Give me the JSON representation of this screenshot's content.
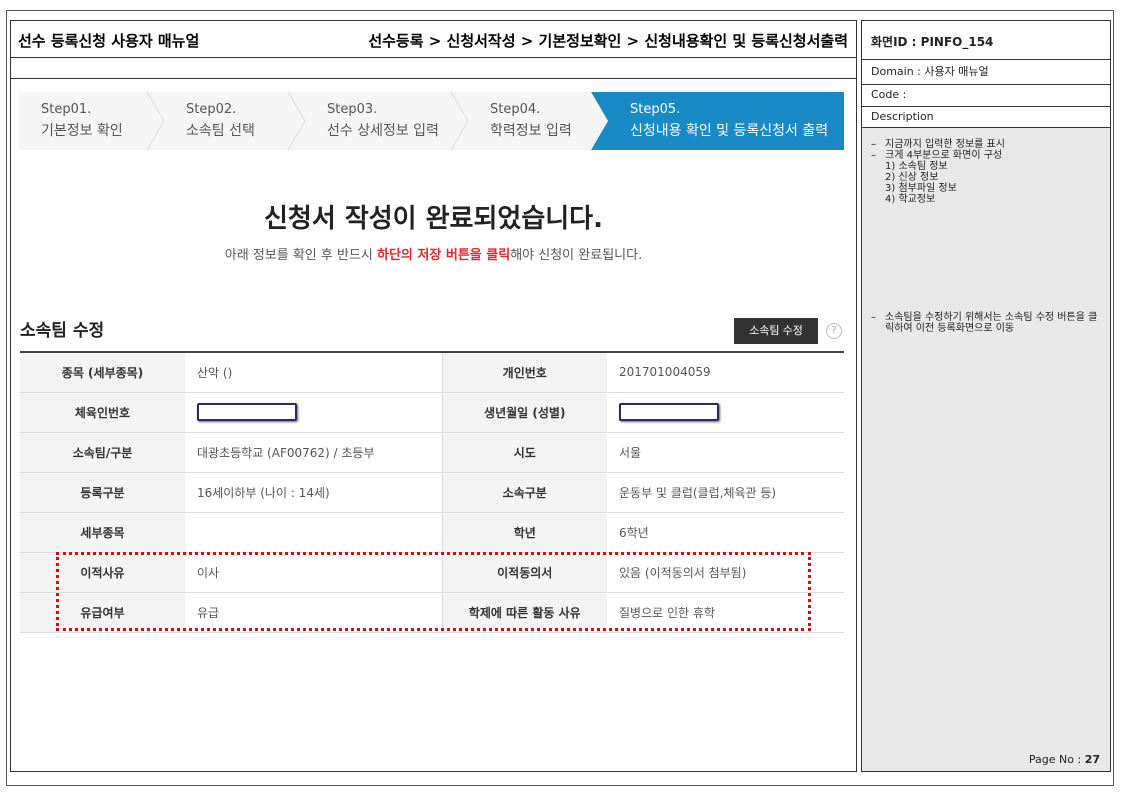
{
  "header": {
    "title": "선수 등록신청 사용자 매뉴얼",
    "path": "선수등록 > 신청서작성 > 기본정보확인 > 신청내용확인 및 등록신청서출력"
  },
  "steps": [
    {
      "num": "Step01.",
      "label": "기본정보 확인"
    },
    {
      "num": "Step02.",
      "label": "소속팀 선택"
    },
    {
      "num": "Step03.",
      "label": "선수 상세정보 입력"
    },
    {
      "num": "Step04.",
      "label": "학력정보 입력"
    },
    {
      "num": "Step05.",
      "label": "신청내용 확인 및 등록신청서 출력"
    }
  ],
  "complete": {
    "title": "신청서 작성이 완료되었습니다.",
    "sub_before": "아래 정보를 확인 후 반드시 ",
    "sub_emphasis": "하단의 저장 버튼을 클릭",
    "sub_after": "해야 신청이 완료됩니다."
  },
  "section": {
    "title": "소속팀 수정",
    "edit_button": "소속팀 수정",
    "help": "?"
  },
  "table": {
    "rows": [
      {
        "h1": "종목 (세부종목)",
        "v1": "산악 ()",
        "h2": "개인번호",
        "v2": "201701004059"
      },
      {
        "h1": "체육인번호",
        "v1": "",
        "h2": "생년월일 (성별)",
        "v2": ""
      },
      {
        "h1": "소속팀/구분",
        "v1": "대광초등학교 (AF00762) / 초등부",
        "h2": "시도",
        "v2": "서울"
      },
      {
        "h1": "등록구분",
        "v1": "16세이하부 (나이 : 14세)",
        "h2": "소속구분",
        "v2": "운동부 및 클럽(클럽,체육관 등)"
      },
      {
        "h1": "세부종목",
        "v1": "",
        "h2": "학년",
        "v2": "6학년"
      },
      {
        "h1": "이적사유",
        "v1": "이사",
        "h2": "이적동의서",
        "v2": "있음 (이적동의서 첨부됨)"
      },
      {
        "h1": "유급여부",
        "v1": "유급",
        "h2": "학제에 따른 활동 사유",
        "v2": "질병으로 인한 휴학"
      }
    ]
  },
  "panel": {
    "screen_id": "화면ID : PINFO_154",
    "domain": "Domain : 사용자 매뉴얼",
    "code": "Code :",
    "description": "Description",
    "notes1": [
      "지금까지 입력한 정보를 표시",
      "크게 4부분으로 화면이 구성"
    ],
    "notes1_sub": [
      "1) 소속팀 정보",
      "2) 신상 정보",
      "3) 첨부파일 정보",
      "4) 학교정보"
    ],
    "note2": "소속팀을 수정하기 위해서는 소속팀 수정 버튼을 클릭하여 이전 등록화면으로 이동",
    "page_label": "Page No :",
    "page_no": "27"
  },
  "colors": {
    "active_step": "#1a8ac6",
    "emphasis": "#e1262b",
    "highlight_box": "#c8101b"
  }
}
